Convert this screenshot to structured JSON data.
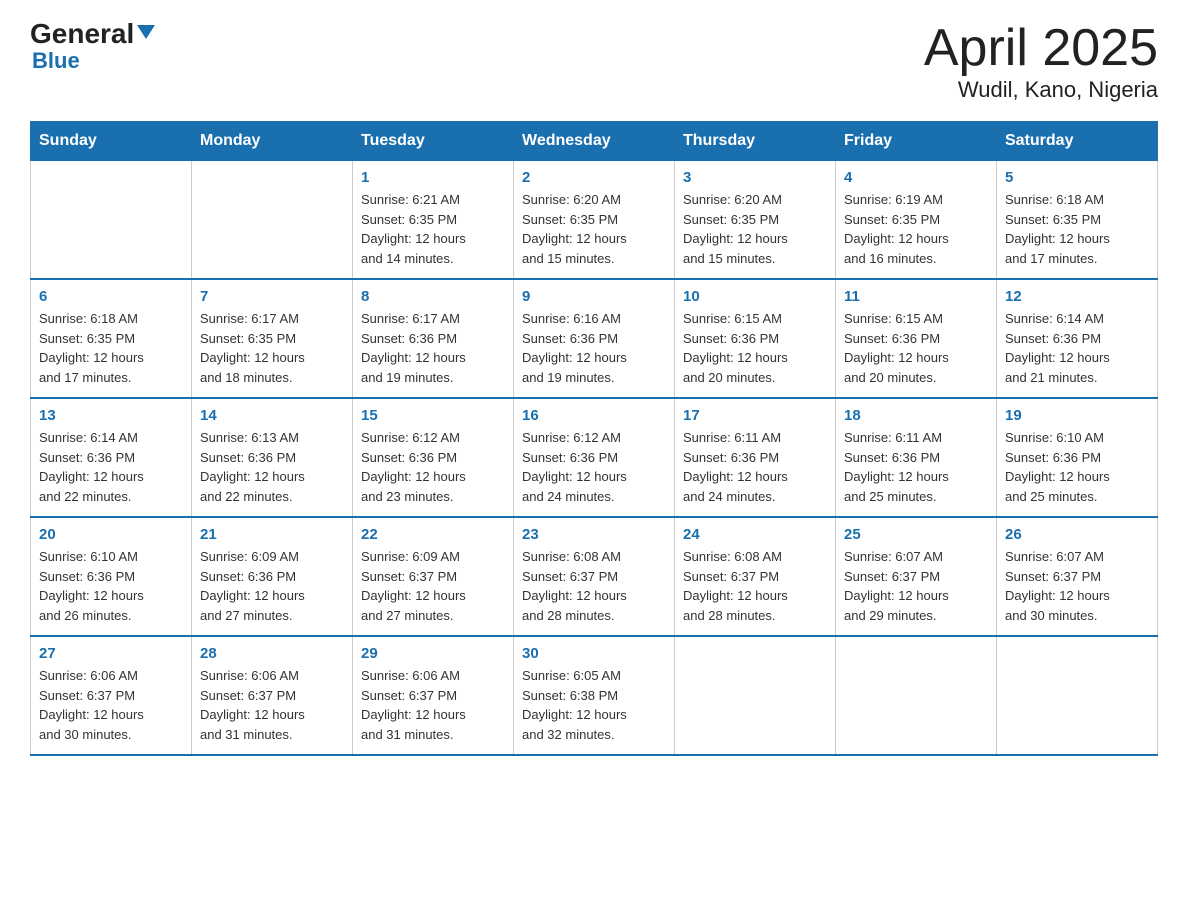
{
  "header": {
    "logo_general": "General",
    "logo_blue": "Blue",
    "month_year": "April 2025",
    "location": "Wudil, Kano, Nigeria"
  },
  "weekdays": [
    "Sunday",
    "Monday",
    "Tuesday",
    "Wednesday",
    "Thursday",
    "Friday",
    "Saturday"
  ],
  "weeks": [
    [
      {
        "day": "",
        "info": ""
      },
      {
        "day": "",
        "info": ""
      },
      {
        "day": "1",
        "info": "Sunrise: 6:21 AM\nSunset: 6:35 PM\nDaylight: 12 hours\nand 14 minutes."
      },
      {
        "day": "2",
        "info": "Sunrise: 6:20 AM\nSunset: 6:35 PM\nDaylight: 12 hours\nand 15 minutes."
      },
      {
        "day": "3",
        "info": "Sunrise: 6:20 AM\nSunset: 6:35 PM\nDaylight: 12 hours\nand 15 minutes."
      },
      {
        "day": "4",
        "info": "Sunrise: 6:19 AM\nSunset: 6:35 PM\nDaylight: 12 hours\nand 16 minutes."
      },
      {
        "day": "5",
        "info": "Sunrise: 6:18 AM\nSunset: 6:35 PM\nDaylight: 12 hours\nand 17 minutes."
      }
    ],
    [
      {
        "day": "6",
        "info": "Sunrise: 6:18 AM\nSunset: 6:35 PM\nDaylight: 12 hours\nand 17 minutes."
      },
      {
        "day": "7",
        "info": "Sunrise: 6:17 AM\nSunset: 6:35 PM\nDaylight: 12 hours\nand 18 minutes."
      },
      {
        "day": "8",
        "info": "Sunrise: 6:17 AM\nSunset: 6:36 PM\nDaylight: 12 hours\nand 19 minutes."
      },
      {
        "day": "9",
        "info": "Sunrise: 6:16 AM\nSunset: 6:36 PM\nDaylight: 12 hours\nand 19 minutes."
      },
      {
        "day": "10",
        "info": "Sunrise: 6:15 AM\nSunset: 6:36 PM\nDaylight: 12 hours\nand 20 minutes."
      },
      {
        "day": "11",
        "info": "Sunrise: 6:15 AM\nSunset: 6:36 PM\nDaylight: 12 hours\nand 20 minutes."
      },
      {
        "day": "12",
        "info": "Sunrise: 6:14 AM\nSunset: 6:36 PM\nDaylight: 12 hours\nand 21 minutes."
      }
    ],
    [
      {
        "day": "13",
        "info": "Sunrise: 6:14 AM\nSunset: 6:36 PM\nDaylight: 12 hours\nand 22 minutes."
      },
      {
        "day": "14",
        "info": "Sunrise: 6:13 AM\nSunset: 6:36 PM\nDaylight: 12 hours\nand 22 minutes."
      },
      {
        "day": "15",
        "info": "Sunrise: 6:12 AM\nSunset: 6:36 PM\nDaylight: 12 hours\nand 23 minutes."
      },
      {
        "day": "16",
        "info": "Sunrise: 6:12 AM\nSunset: 6:36 PM\nDaylight: 12 hours\nand 24 minutes."
      },
      {
        "day": "17",
        "info": "Sunrise: 6:11 AM\nSunset: 6:36 PM\nDaylight: 12 hours\nand 24 minutes."
      },
      {
        "day": "18",
        "info": "Sunrise: 6:11 AM\nSunset: 6:36 PM\nDaylight: 12 hours\nand 25 minutes."
      },
      {
        "day": "19",
        "info": "Sunrise: 6:10 AM\nSunset: 6:36 PM\nDaylight: 12 hours\nand 25 minutes."
      }
    ],
    [
      {
        "day": "20",
        "info": "Sunrise: 6:10 AM\nSunset: 6:36 PM\nDaylight: 12 hours\nand 26 minutes."
      },
      {
        "day": "21",
        "info": "Sunrise: 6:09 AM\nSunset: 6:36 PM\nDaylight: 12 hours\nand 27 minutes."
      },
      {
        "day": "22",
        "info": "Sunrise: 6:09 AM\nSunset: 6:37 PM\nDaylight: 12 hours\nand 27 minutes."
      },
      {
        "day": "23",
        "info": "Sunrise: 6:08 AM\nSunset: 6:37 PM\nDaylight: 12 hours\nand 28 minutes."
      },
      {
        "day": "24",
        "info": "Sunrise: 6:08 AM\nSunset: 6:37 PM\nDaylight: 12 hours\nand 28 minutes."
      },
      {
        "day": "25",
        "info": "Sunrise: 6:07 AM\nSunset: 6:37 PM\nDaylight: 12 hours\nand 29 minutes."
      },
      {
        "day": "26",
        "info": "Sunrise: 6:07 AM\nSunset: 6:37 PM\nDaylight: 12 hours\nand 30 minutes."
      }
    ],
    [
      {
        "day": "27",
        "info": "Sunrise: 6:06 AM\nSunset: 6:37 PM\nDaylight: 12 hours\nand 30 minutes."
      },
      {
        "day": "28",
        "info": "Sunrise: 6:06 AM\nSunset: 6:37 PM\nDaylight: 12 hours\nand 31 minutes."
      },
      {
        "day": "29",
        "info": "Sunrise: 6:06 AM\nSunset: 6:37 PM\nDaylight: 12 hours\nand 31 minutes."
      },
      {
        "day": "30",
        "info": "Sunrise: 6:05 AM\nSunset: 6:38 PM\nDaylight: 12 hours\nand 32 minutes."
      },
      {
        "day": "",
        "info": ""
      },
      {
        "day": "",
        "info": ""
      },
      {
        "day": "",
        "info": ""
      }
    ]
  ]
}
